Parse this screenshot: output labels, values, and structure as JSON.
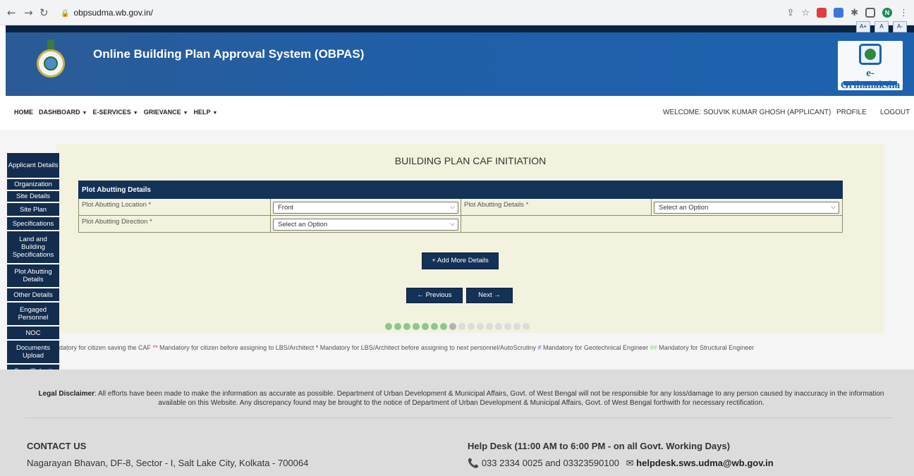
{
  "browser": {
    "url": "obpsudma.wb.gov.in/",
    "ext_letter": "N"
  },
  "header": {
    "title": "Online Building Plan Approval System (OBPAS)",
    "brand": "e-Grihanaksha"
  },
  "topnav": {
    "menu": [
      {
        "label": "HOME",
        "dropdown": false
      },
      {
        "label": "DASHBOARD",
        "dropdown": true
      },
      {
        "label": "E-SERVICES",
        "dropdown": true
      },
      {
        "label": "GRIEVANCE",
        "dropdown": true
      },
      {
        "label": "HELP",
        "dropdown": true
      }
    ],
    "welcome": "WELCOME: SOUVIK KUMAR GHOSH (APPLICANT)",
    "profile": "PROFILE",
    "logout": "LOGOUT"
  },
  "sidenav": [
    "Applicant Details",
    "Organization",
    "Site Details",
    "Site Plan",
    "Specifications",
    "Land and Building Specifications",
    "Plot Abutting Details",
    "Other Details",
    "Engaged Personnel",
    "NOC",
    "Documents Upload",
    "Save/Submit"
  ],
  "form": {
    "page_title": "BUILDING PLAN CAF INITIATION",
    "section_title": "Plot Abutting Details",
    "location_label": "Plot Abutting Location *",
    "location_value": "Front",
    "details_label": "Plot Abutting Details *",
    "details_value": "Select an Option",
    "direction_label": "Plot Abutting Direction *",
    "direction_value": "Select an Option",
    "add_more": "+ Add More Details",
    "previous": "←  Previous",
    "next": "Next  →",
    "progress": {
      "total": 16,
      "completed": 7,
      "current_index": 7
    }
  },
  "colors": {
    "dot_done": "#8bc88b",
    "dot_current": "#b3b3b3",
    "dot_todo": "#dcdcdc",
    "nav_dark": "#143156"
  },
  "legend": {
    "t1": "datory for citizen saving the CAF",
    "m1": "**",
    "t2": "Mandatory for citizen before assigning to LBS/Architect",
    "m2": "*",
    "t3": "Mandatory for LBS/Architect before assigning to next personnel/AutoScrutiny",
    "m3": "#",
    "t4": "Mandatory for Geotechnical Engineer",
    "m4": "##",
    "t5": "Mandatory for Structural Engineer"
  },
  "footer": {
    "disclaimer_label": "Legal Disclaimer",
    "disclaimer_text": ": All efforts have been made to make the information as accurate as possible. Department of Urban Development & Municipal Affairs, Govt. of West Bengal will not be responsible for any loss/damage to any person caused by inaccuracy in the information available on this Website. Any discrepancy found may be brought to the notice of Department of Urban Development & Municipal Affairs, Govt. of West Bengal forthwith for necessary rectification.",
    "contact_heading": "CONTACT US",
    "contact_address": "Nagarayan Bhavan, DF-8, Sector - I, Salt Lake City, Kolkata - 700064",
    "help_heading": "Help Desk (11:00 AM to 6:00 PM - on all Govt. Working Days)",
    "help_phone": "033 2334 0025 and 03323590100",
    "help_email": "helpdesk.sws.udma@wb.gov.in"
  }
}
